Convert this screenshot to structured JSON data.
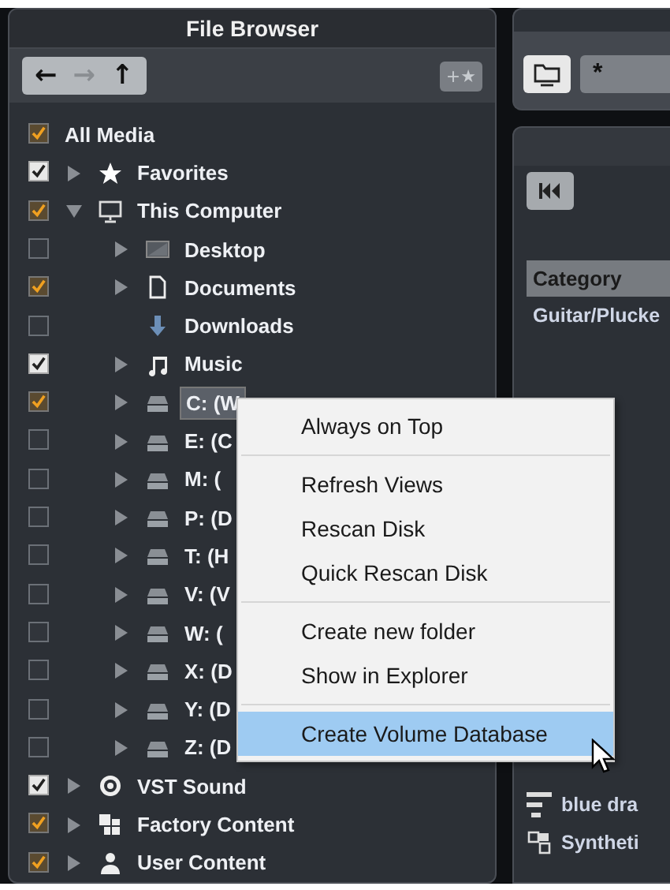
{
  "file_browser": {
    "title": "File Browser",
    "nav_buttons": [
      {
        "label": "←",
        "disabled": false
      },
      {
        "label": "→",
        "disabled": true
      },
      {
        "label": "↑",
        "disabled": false
      }
    ],
    "favorite_button": {
      "label": "+★"
    },
    "tree": [
      {
        "label": "All Media",
        "checked": true,
        "partial": true,
        "selected": false,
        "children": [
          {
            "label": "Favorites",
            "kind": "star",
            "checked": true,
            "partial": false,
            "selected": false,
            "expanded": false
          },
          {
            "label": "This Computer",
            "kind": "monitor",
            "checked": true,
            "partial": true,
            "selected": false,
            "expanded": true,
            "children": [
              {
                "label": "Desktop",
                "kind": "desktop",
                "checked": false,
                "selected": false,
                "expanded": false
              },
              {
                "label": "Documents",
                "kind": "document",
                "checked": true,
                "partial": true,
                "selected": false,
                "expanded": false
              },
              {
                "label": "Downloads",
                "kind": "download",
                "checked": false,
                "selected": false
              },
              {
                "label": "Music",
                "kind": "music",
                "checked": true,
                "partial": false,
                "selected": false,
                "expanded": false
              },
              {
                "label": "C: (W",
                "kind": "drive",
                "checked": true,
                "partial": true,
                "selected": true,
                "expanded": false
              },
              {
                "label": "E: (C",
                "kind": "drive",
                "checked": false,
                "selected": false,
                "expanded": false
              },
              {
                "label": "M: (",
                "kind": "drive",
                "checked": false,
                "selected": false,
                "expanded": false
              },
              {
                "label": "P: (D",
                "kind": "drive",
                "checked": false,
                "selected": false,
                "expanded": false
              },
              {
                "label": "T: (H",
                "kind": "drive",
                "checked": false,
                "selected": false,
                "expanded": false
              },
              {
                "label": "V: (V",
                "kind": "drive",
                "checked": false,
                "selected": false,
                "expanded": false
              },
              {
                "label": "W: (",
                "kind": "drive",
                "checked": false,
                "selected": false,
                "expanded": false
              },
              {
                "label": "X: (D",
                "kind": "drive",
                "checked": false,
                "selected": false,
                "expanded": false
              },
              {
                "label": "Y: (D",
                "kind": "drive",
                "checked": false,
                "selected": false,
                "expanded": false
              },
              {
                "label": "Z: (D",
                "kind": "drive",
                "checked": false,
                "selected": false,
                "expanded": false
              }
            ]
          },
          {
            "label": "VST Sound",
            "kind": "vst",
            "checked": true,
            "partial": false,
            "selected": false,
            "expanded": false
          },
          {
            "label": "Factory Content",
            "kind": "factory",
            "checked": true,
            "partial": true,
            "selected": false,
            "expanded": false
          },
          {
            "label": "User Content",
            "kind": "user",
            "checked": true,
            "partial": true,
            "selected": false,
            "expanded": false
          }
        ]
      }
    ]
  },
  "filter_bar": {
    "search": {
      "value": "*"
    }
  },
  "results": {
    "column_header": "Category",
    "rows": [
      {
        "text": "Guitar/Plucke",
        "kind": "plain"
      },
      {
        "text": "blue dra",
        "kind": "lines"
      },
      {
        "text": "Syntheti",
        "kind": "blocks"
      }
    ]
  },
  "context_menu": {
    "groups": [
      [
        {
          "label": "Always on Top",
          "highlighted": false
        }
      ],
      [
        {
          "label": "Refresh Views",
          "highlighted": false
        },
        {
          "label": "Rescan Disk",
          "highlighted": false
        },
        {
          "label": "Quick Rescan Disk",
          "highlighted": false
        }
      ],
      [
        {
          "label": "Create new folder",
          "highlighted": false
        },
        {
          "label": "Show in Explorer",
          "highlighted": false
        }
      ],
      [
        {
          "label": "Create Volume Database",
          "highlighted": true
        }
      ]
    ]
  }
}
